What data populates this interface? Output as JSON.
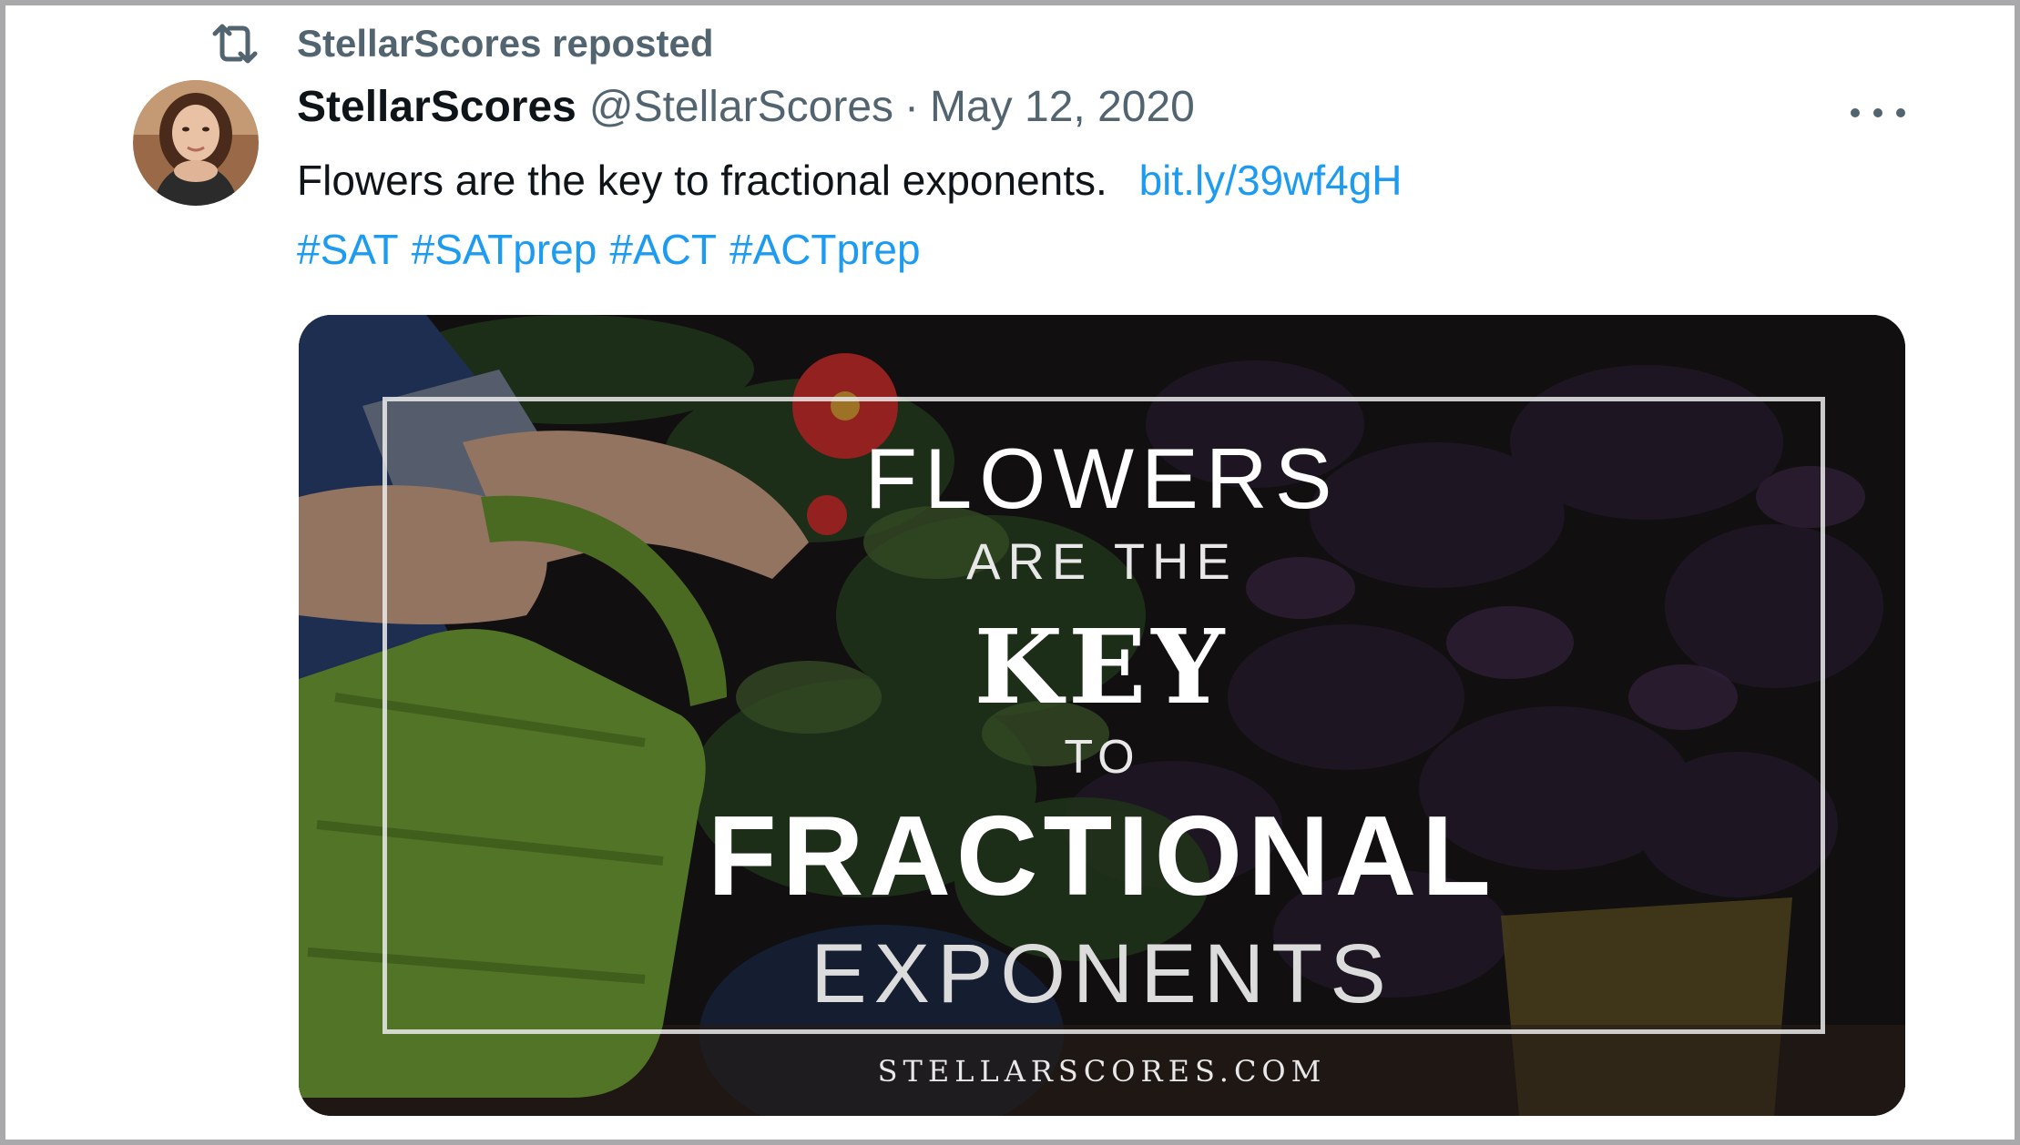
{
  "repost": {
    "label": "StellarScores reposted",
    "icon": "repost-icon"
  },
  "tweet": {
    "display_name": "StellarScores",
    "handle": "@StellarScores",
    "separator": "·",
    "date": "May 12, 2020",
    "more_icon": "more-dots-icon",
    "text": "Flowers are the key to fractional exponents.",
    "link": "bit.ly/39wf4gH",
    "hashtags": [
      "#SAT",
      "#SATprep",
      "#ACT",
      "#ACTprep"
    ]
  },
  "media": {
    "line1": "FLOWERS",
    "line2": "ARE THE",
    "line3": "KEY",
    "line4": "TO",
    "line5": "FRACTIONAL",
    "line6": "EXPONENTS",
    "footer": "STELLARSCORES.COM"
  },
  "colors": {
    "link": "#1d9bf0",
    "secondary_text": "#536471",
    "primary_text": "#0f1419"
  }
}
